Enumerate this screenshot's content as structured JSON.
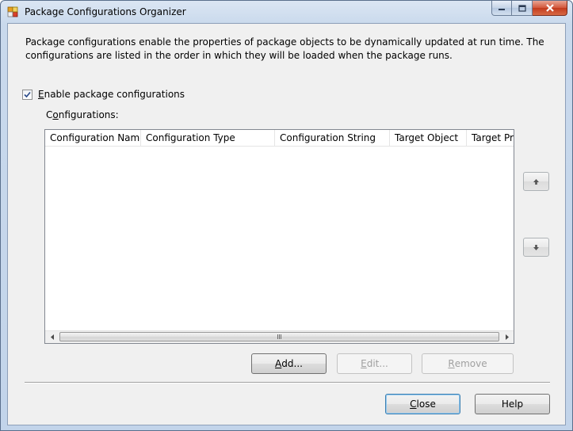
{
  "window": {
    "title": "Package Configurations Organizer",
    "accent_color": "#c2d4ea"
  },
  "description": "Package configurations enable the properties of package objects to be dynamically updated at run time. The configurations are listed in the order in which they will be loaded when the package runs.",
  "enable_checkbox": {
    "checked": true,
    "label_accel": "E",
    "label_rest": "nable package configurations"
  },
  "configurations": {
    "label_pre": "C",
    "label_accel": "o",
    "label_rest": "nfigurations:",
    "columns": [
      "Configuration Name",
      "Configuration Type",
      "Configuration String",
      "Target Object",
      "Target Property"
    ],
    "rows": []
  },
  "buttons": {
    "add": {
      "accel": "A",
      "rest": "dd..."
    },
    "edit": {
      "accel": "E",
      "rest": "dit..."
    },
    "remove": {
      "accel": "R",
      "rest": "emove"
    },
    "close": {
      "accel": "C",
      "rest": "lose"
    },
    "help": "Help"
  },
  "icons": {
    "app": "package-icon",
    "move_up": "arrow-up-icon",
    "move_down": "arrow-down-icon"
  }
}
